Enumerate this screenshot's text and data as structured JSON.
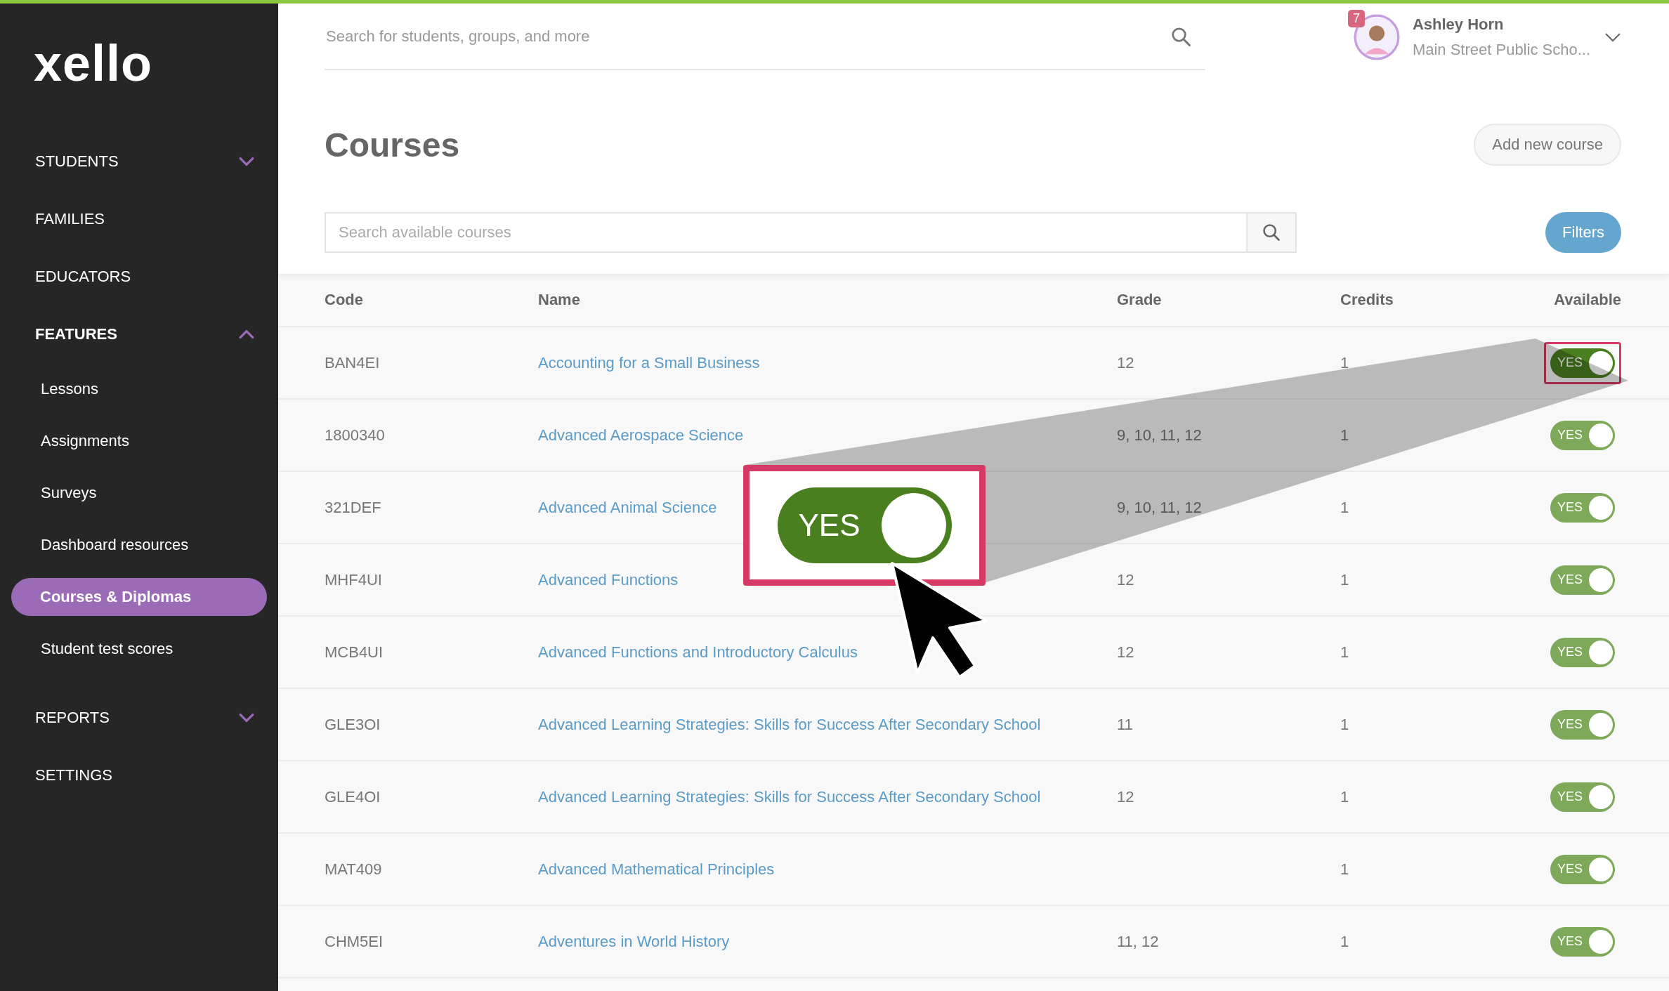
{
  "sidebar": {
    "logo": "xello",
    "items": [
      {
        "label": "STUDENTS",
        "kind": "section",
        "expanded": false,
        "selected": false
      },
      {
        "label": "FAMILIES",
        "kind": "link",
        "selected": false
      },
      {
        "label": "EDUCATORS",
        "kind": "link",
        "selected": false
      },
      {
        "label": "FEATURES",
        "kind": "section",
        "expanded": true,
        "selected": true,
        "children": [
          {
            "label": "Lessons",
            "selected": false
          },
          {
            "label": "Assignments",
            "selected": false
          },
          {
            "label": "Surveys",
            "selected": false
          },
          {
            "label": "Dashboard resources",
            "selected": false
          },
          {
            "label": "Courses & Diplomas",
            "selected": true
          },
          {
            "label": "Student test scores",
            "selected": false
          }
        ]
      },
      {
        "label": "REPORTS",
        "kind": "section",
        "expanded": false,
        "selected": false
      },
      {
        "label": "SETTINGS",
        "kind": "link",
        "selected": false
      }
    ]
  },
  "header": {
    "search": {
      "placeholder": "Search for students, groups, and more"
    },
    "user": {
      "name": "Ashley Horn",
      "school": "Main Street Public Scho...",
      "notifications": "7"
    }
  },
  "page": {
    "title": "Courses",
    "add_button": "Add new course",
    "search": {
      "placeholder": "Search available courses"
    },
    "filters_button": "Filters"
  },
  "table": {
    "columns": [
      "Code",
      "Name",
      "Grade",
      "Credits",
      "Available"
    ],
    "rows": [
      {
        "code": "BAN4EI",
        "name": "Accounting for a Small Business",
        "grade": "12",
        "credits": "1",
        "available": {
          "label": "YES",
          "on": true,
          "highlighted": true
        }
      },
      {
        "code": "1800340",
        "name": "Advanced Aerospace Science",
        "grade": "9, 10, 11, 12",
        "credits": "1",
        "available": {
          "label": "YES",
          "on": true,
          "highlighted": false
        }
      },
      {
        "code": "321DEF",
        "name": "Advanced Animal Science",
        "grade": "9, 10, 11, 12",
        "credits": "1",
        "available": {
          "label": "YES",
          "on": true,
          "highlighted": false
        }
      },
      {
        "code": "MHF4UI",
        "name": "Advanced Functions",
        "grade": "12",
        "credits": "1",
        "available": {
          "label": "YES",
          "on": true,
          "highlighted": false
        }
      },
      {
        "code": "MCB4UI",
        "name": "Advanced Functions and Introductory Calculus",
        "grade": "12",
        "credits": "1",
        "available": {
          "label": "YES",
          "on": true,
          "highlighted": false
        }
      },
      {
        "code": "GLE3OI",
        "name": "Advanced Learning Strategies: Skills for Success After Secondary School",
        "grade": "11",
        "credits": "1",
        "available": {
          "label": "YES",
          "on": true,
          "highlighted": false
        }
      },
      {
        "code": "GLE4OI",
        "name": "Advanced Learning Strategies: Skills for Success After Secondary School",
        "grade": "12",
        "credits": "1",
        "available": {
          "label": "YES",
          "on": true,
          "highlighted": false
        }
      },
      {
        "code": "MAT409",
        "name": "Advanced Mathematical Principles",
        "credits": "1",
        "available": {
          "label": "YES",
          "on": true,
          "highlighted": false
        }
      },
      {
        "code": "CHM5EI",
        "name": "Adventures in World History",
        "grade": "11, 12",
        "credits": "1",
        "available": {
          "label": "YES",
          "on": true,
          "highlighted": false
        }
      }
    ]
  },
  "callout": {
    "label": "YES",
    "on": true
  }
}
